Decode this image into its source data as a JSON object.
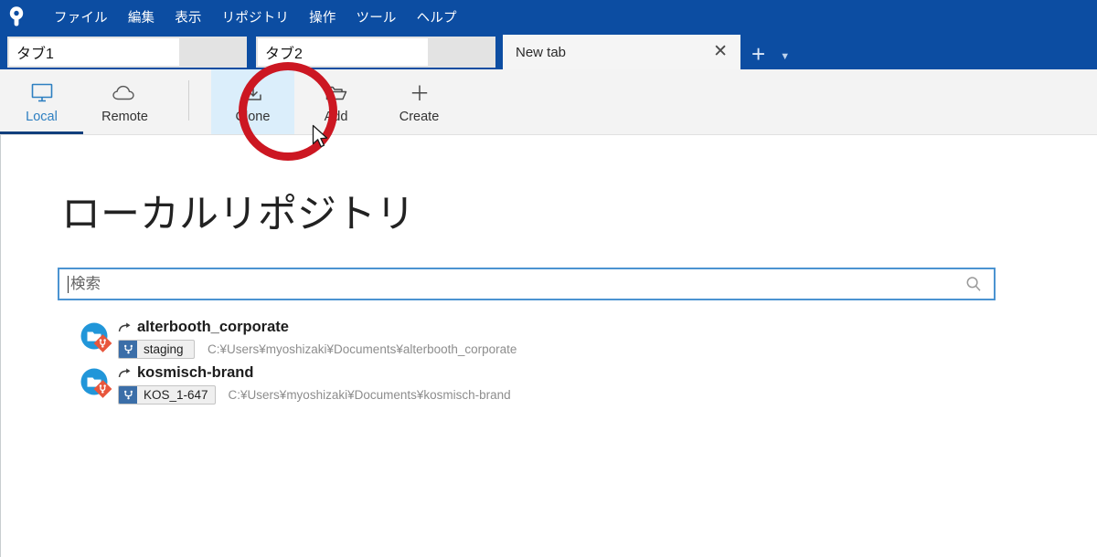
{
  "window": {
    "app_logo": "sourcetree-logo-icon",
    "accent_blue": "#0c4da2",
    "annotation_color": "#cc1722"
  },
  "menu": {
    "items": [
      {
        "label": "ファイル"
      },
      {
        "label": "編集"
      },
      {
        "label": "表示"
      },
      {
        "label": "リポジトリ"
      },
      {
        "label": "操作"
      },
      {
        "label": "ツール"
      },
      {
        "label": "ヘルプ"
      }
    ]
  },
  "tabs": {
    "items": [
      {
        "label": "タブ1",
        "active": false
      },
      {
        "label": "タブ2",
        "active": false
      },
      {
        "label": "New tab",
        "active": true
      }
    ],
    "close_icon": "✕",
    "new_tab_icon": "+",
    "tab_menu_icon": "▼"
  },
  "toolbar": {
    "buttons": [
      {
        "label": "Local",
        "icon": "monitor-icon",
        "state": "active"
      },
      {
        "label": "Remote",
        "icon": "cloud-icon",
        "state": "normal"
      },
      {
        "label": "Clone",
        "icon": "download-arrow-icon",
        "state": "hover"
      },
      {
        "label": "Add",
        "icon": "folder-open-icon",
        "state": "normal"
      },
      {
        "label": "Create",
        "icon": "plus-icon",
        "state": "normal"
      }
    ]
  },
  "main": {
    "title": "ローカルリポジトリ",
    "search": {
      "placeholder": "検索",
      "value": "",
      "icon": "search-icon"
    },
    "repositories": [
      {
        "name": "alterbooth_corporate",
        "branch": "staging",
        "path": "C:¥Users¥myoshizaki¥Documents¥alterbooth_corporate",
        "icon": "repository-folder-icon",
        "branch_icon": "branch-icon",
        "arrow_icon": "curved-arrow-icon"
      },
      {
        "name": "kosmisch-brand",
        "branch": "KOS_1-647",
        "path": "C:¥Users¥myoshizaki¥Documents¥kosmisch-brand",
        "icon": "repository-folder-icon",
        "branch_icon": "branch-icon",
        "arrow_icon": "curved-arrow-icon"
      }
    ]
  },
  "annotation": {
    "highlighted_button": "Clone",
    "shape": "circle"
  }
}
